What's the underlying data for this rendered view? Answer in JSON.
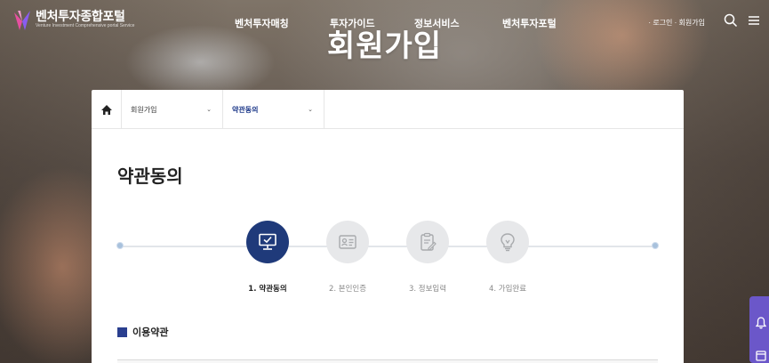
{
  "header": {
    "logo_text": "벤처투자종합포털",
    "logo_subtitle": "Venture Investment Comprehensive portal Service",
    "nav": [
      "벤처투자매칭",
      "투자가이드",
      "정보서비스",
      "벤처투자포털"
    ],
    "util": {
      "login": "로그인",
      "join": "회원가입",
      "separator": "·"
    }
  },
  "page_heading": "회원가입",
  "breadcrumb": {
    "first": "회원가입",
    "second": "약관동의",
    "arrow": "⌄"
  },
  "section_title": "약관동의",
  "steps": [
    {
      "label": "1. 약관동의",
      "icon": "monitor-check-icon",
      "active": true
    },
    {
      "label": "2. 본인인증",
      "icon": "id-card-icon",
      "active": false
    },
    {
      "label": "3. 정보입력",
      "icon": "clipboard-edit-icon",
      "active": false
    },
    {
      "label": "4. 가입완료",
      "icon": "lightbulb-icon",
      "active": false
    }
  ],
  "terms_heading": "이용약관",
  "colors": {
    "accent": "#1f3a7a",
    "square": "#2a3f8f",
    "quick_menu": "#6b57c9"
  }
}
